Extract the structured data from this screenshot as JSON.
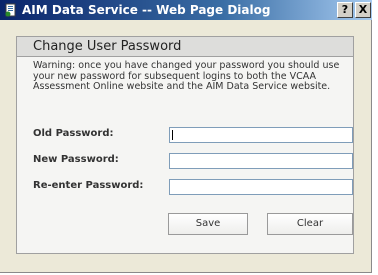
{
  "window": {
    "title": "AIM Data Service -- Web Page Dialog",
    "help_label": "?",
    "close_label": "X"
  },
  "panel": {
    "title": "Change User Password",
    "warning": "Warning: once you have changed your password you should use your new password for subsequent logins to both the VCAA Assessment Online website and the AIM Data Service website."
  },
  "form": {
    "old_password_label": "Old Password:",
    "old_password_value": "",
    "new_password_label": "New Password:",
    "new_password_value": "",
    "reenter_password_label": "Re-enter Password:",
    "reenter_password_value": ""
  },
  "buttons": {
    "save_label": "Save",
    "clear_label": "Clear"
  },
  "colors": {
    "titlebar_start": "#0a246a",
    "titlebar_end": "#a6caf0",
    "dialog_background": "#ece9d8",
    "panel_background": "#f5f5f3",
    "input_border": "#7f9db9"
  },
  "icons": {
    "window_icon": "page-dialog-icon"
  }
}
